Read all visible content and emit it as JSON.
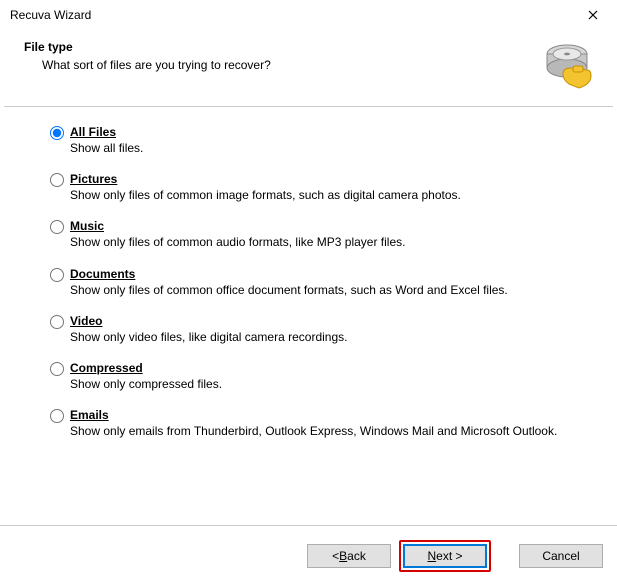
{
  "titlebar": {
    "title": "Recuva Wizard"
  },
  "header": {
    "heading": "File type",
    "subheading": "What sort of files are you trying to recover?"
  },
  "options": [
    {
      "label": "All Files",
      "desc": "Show all files.",
      "checked": true
    },
    {
      "label": "Pictures",
      "desc": "Show only files of common image formats, such as digital camera photos.",
      "checked": false
    },
    {
      "label": "Music",
      "desc": "Show only files of common audio formats, like MP3 player files.",
      "checked": false
    },
    {
      "label": "Documents",
      "desc": "Show only files of common office document formats, such as Word and Excel files.",
      "checked": false
    },
    {
      "label": "Video",
      "desc": "Show only video files, like digital camera recordings.",
      "checked": false
    },
    {
      "label": "Compressed",
      "desc": "Show only compressed files.",
      "checked": false
    },
    {
      "label": "Emails",
      "desc": "Show only emails from Thunderbird, Outlook Express, Windows Mail and Microsoft Outlook.",
      "checked": false
    }
  ],
  "buttons": {
    "back_prefix": "< ",
    "back_u": "B",
    "back_rest": "ack",
    "next_u": "N",
    "next_rest": "ext >",
    "cancel": "Cancel"
  }
}
